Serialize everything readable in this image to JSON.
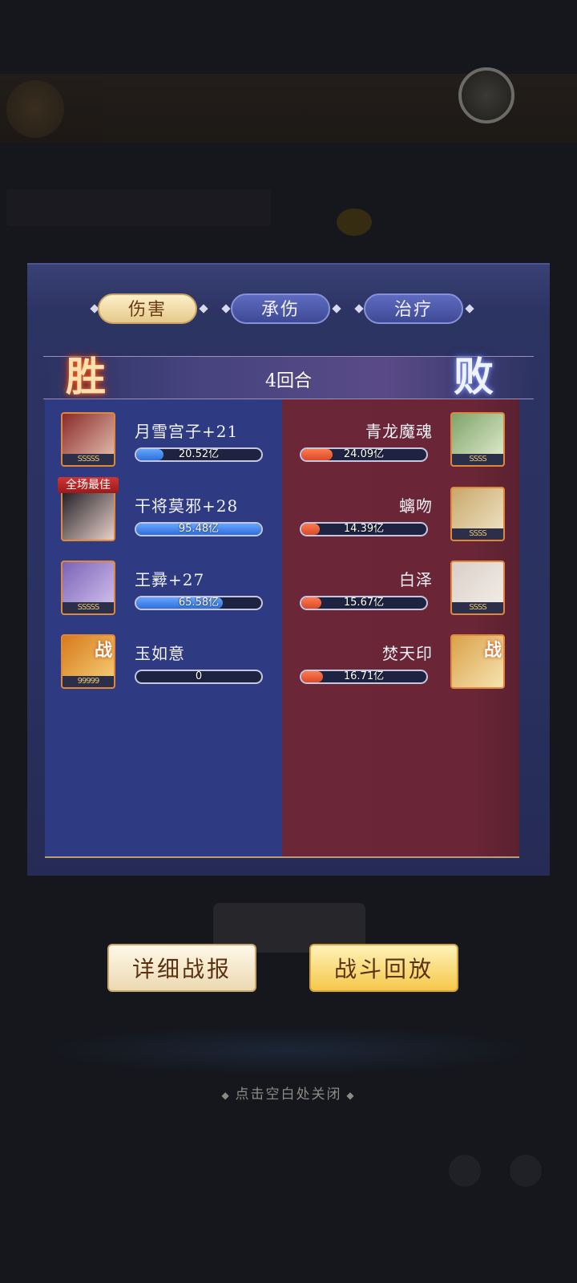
{
  "tabs": [
    {
      "label": "伤害",
      "active": true
    },
    {
      "label": "承伤",
      "active": false
    },
    {
      "label": "治疗",
      "active": false
    }
  ],
  "round": "4回合",
  "result_left": "胜",
  "result_right": "败",
  "best_tag": "全场最佳",
  "left_team": [
    {
      "name": "月雪宫子+21",
      "value": "20.52亿",
      "fill": 0.22,
      "stars": "SSSSS",
      "color_a": "#8a2a2a",
      "color_b": "#e8c7b5"
    },
    {
      "name": "干将莫邪+28",
      "value": "95.48亿",
      "fill": 1.0,
      "stars": "",
      "color_a": "#1c1a22",
      "color_b": "#e8d0c8",
      "best": true
    },
    {
      "name": "王彛+27",
      "value": "65.58亿",
      "fill": 0.69,
      "stars": "SSSSS",
      "color_a": "#7b62b8",
      "color_b": "#d7c6f0"
    },
    {
      "name": "玉如意",
      "value": "0",
      "fill": 0.0,
      "stars": "99999",
      "color_a": "#d87a1c",
      "color_b": "#f6d27a",
      "zhan": "战"
    }
  ],
  "right_team": [
    {
      "name": "青龙魔魂",
      "value": "24.09亿",
      "fill": 0.25,
      "stars": "SSSS",
      "color_a": "#7ea36a",
      "color_b": "#e6efd2"
    },
    {
      "name": "螭吻",
      "value": "14.39亿",
      "fill": 0.15,
      "stars": "SSSS",
      "color_a": "#c8a86a",
      "color_b": "#f1e6c9"
    },
    {
      "name": "白泽",
      "value": "15.67亿",
      "fill": 0.16,
      "stars": "SSSS",
      "color_a": "#d9cfc8",
      "color_b": "#f5efe9"
    },
    {
      "name": "焚天印",
      "value": "16.71亿",
      "fill": 0.17,
      "stars": "",
      "color_a": "#d9a24a",
      "color_b": "#f7e3b0",
      "zhan": "战"
    }
  ],
  "buttons": {
    "detail": "详细战报",
    "replay": "战斗回放"
  },
  "close_hint": "点击空白处关闭"
}
